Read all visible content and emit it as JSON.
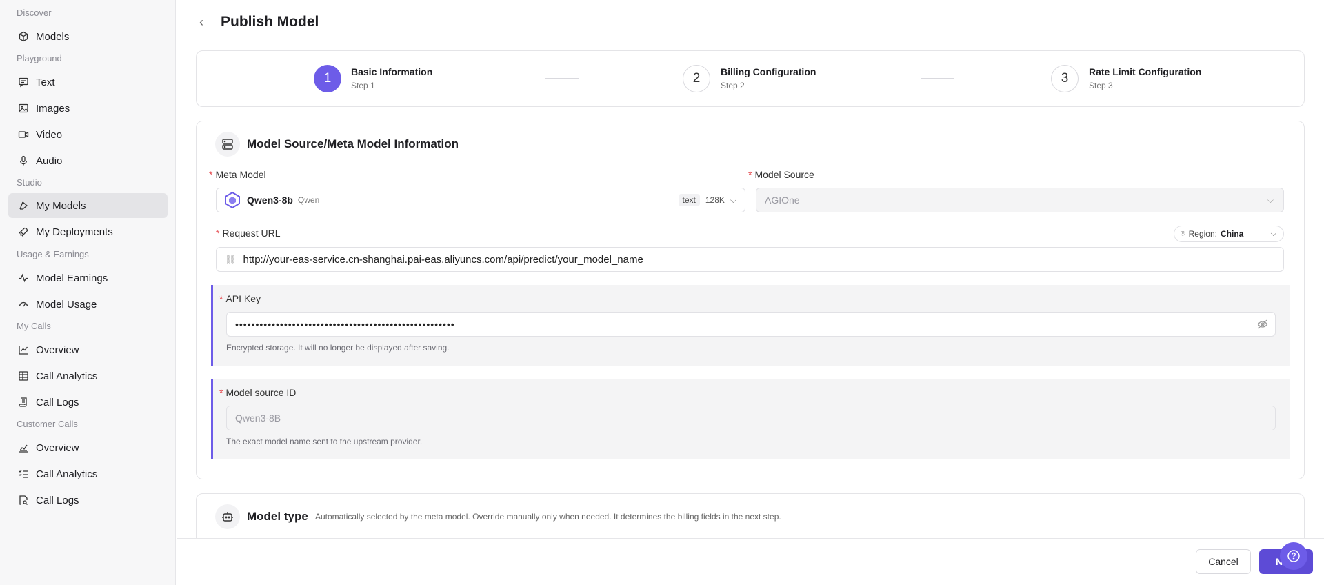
{
  "sidebar": {
    "sections": {
      "discover": "Discover",
      "playground": "Playground",
      "studio": "Studio",
      "usage": "Usage & Earnings",
      "my_calls": "My Calls",
      "customer_calls": "Customer Calls"
    },
    "items": {
      "models": "Models",
      "text": "Text",
      "images": "Images",
      "video": "Video",
      "audio": "Audio",
      "my_models": "My Models",
      "my_deployments": "My Deployments",
      "model_earnings": "Model Earnings",
      "model_usage": "Model Usage",
      "my_overview": "Overview",
      "my_call_analytics": "Call Analytics",
      "my_call_logs": "Call Logs",
      "cust_overview": "Overview",
      "cust_call_analytics": "Call Analytics",
      "cust_call_logs": "Call Logs"
    }
  },
  "page": {
    "title": "Publish Model"
  },
  "steps": [
    {
      "num": "1",
      "title": "Basic Information",
      "sub": "Step 1"
    },
    {
      "num": "2",
      "title": "Billing Configuration",
      "sub": "Step 2"
    },
    {
      "num": "3",
      "title": "Rate Limit Configuration",
      "sub": "Step 3"
    }
  ],
  "source_section": {
    "title": "Model Source/Meta Model Information",
    "meta_model_label": "Meta Model",
    "meta_model_name": "Qwen3-8b",
    "meta_model_vendor": "Qwen",
    "meta_model_modality": "text",
    "meta_model_context": "128K",
    "model_source_label": "Model Source",
    "model_source_value": "AGIOne",
    "request_url_label": "Request URL",
    "region_label": "Region:",
    "region_value": "China",
    "request_url_value": "http://your-eas-service.cn-shanghai.pai-eas.aliyuncs.com/api/predict/your_model_name",
    "api_key_label": "API Key",
    "api_key_value": "••••••••••••••••••••••••••••••••••••••••••••••••••••••",
    "api_key_help": "Encrypted storage. It will no longer be displayed after saving.",
    "source_id_label": "Model source ID",
    "source_id_placeholder": "Qwen3-8B",
    "source_id_help": "The exact model name sent to the upstream provider."
  },
  "type_section": {
    "title": "Model type",
    "desc": "Automatically selected by the meta model. Override manually only when needed. It determines the billing fields in the next step."
  },
  "footer": {
    "cancel": "Cancel",
    "next": "Next"
  },
  "colors": {
    "accent": "#6d5ce8",
    "required": "#e5484d"
  }
}
